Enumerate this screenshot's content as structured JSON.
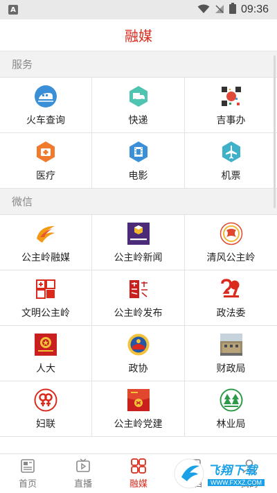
{
  "statusbar": {
    "time": "09:36",
    "notification_letter": "A"
  },
  "header": {
    "title": "融媒"
  },
  "sections": [
    {
      "title": "服务",
      "items": [
        {
          "label": "火车查询",
          "icon": "train-icon",
          "color": "#3b8fd6"
        },
        {
          "label": "快递",
          "icon": "delivery-truck-icon",
          "color": "#4fc4b1"
        },
        {
          "label": "吉事办",
          "icon": "qr-code-icon",
          "color": "#e14a3b"
        },
        {
          "label": "医疗",
          "icon": "medical-kit-icon",
          "color": "#f07b2c"
        },
        {
          "label": "电影",
          "icon": "film-icon",
          "color": "#3b8fd6"
        },
        {
          "label": "机票",
          "icon": "airplane-icon",
          "color": "#3fb1c8"
        }
      ]
    },
    {
      "title": "微信",
      "items": [
        {
          "label": "公主岭融媒",
          "icon": "rongmei-logo-icon",
          "color": "#f29a17"
        },
        {
          "label": "公主岭新闻",
          "icon": "news-logo-icon",
          "color": "#4b2a78"
        },
        {
          "label": "清风公主岭",
          "icon": "qingfeng-logo-icon",
          "color": "#e0472c"
        },
        {
          "label": "文明公主岭",
          "icon": "wenming-logo-icon",
          "color": "#d92a1c"
        },
        {
          "label": "公主岭发布",
          "icon": "fabu-logo-icon",
          "color": "#c91f1f"
        },
        {
          "label": "政法委",
          "icon": "zhengfa-logo-icon",
          "color": "#d92a1c"
        },
        {
          "label": "人大",
          "icon": "renda-emblem-icon",
          "color": "#c91f1f"
        },
        {
          "label": "政协",
          "icon": "zhengxie-emblem-icon",
          "color": "#2457a6"
        },
        {
          "label": "财政局",
          "icon": "building-photo-icon",
          "color": "#8a7a5a"
        },
        {
          "label": "妇联",
          "icon": "fulian-logo-icon",
          "color": "#d92a1c"
        },
        {
          "label": "公主岭党建",
          "icon": "party-building-icon",
          "color": "#c91f1f"
        },
        {
          "label": "林业局",
          "icon": "forestry-logo-icon",
          "color": "#2e9a49"
        }
      ]
    }
  ],
  "bottom_nav": [
    {
      "label": "首页",
      "icon": "home-news-icon",
      "active": false
    },
    {
      "label": "直播",
      "icon": "live-video-icon",
      "active": false
    },
    {
      "label": "融媒",
      "icon": "rongmei-grid-icon",
      "active": true
    },
    {
      "label": "栏目",
      "icon": "column-icon",
      "active": false
    },
    {
      "label": "我的",
      "icon": "profile-icon",
      "active": false
    }
  ],
  "watermark": {
    "title": "飞翔下载",
    "url": "WWW.FXXZ.COM"
  },
  "colors": {
    "accent": "#d92a1c",
    "watermark": "#1aa0e6"
  }
}
